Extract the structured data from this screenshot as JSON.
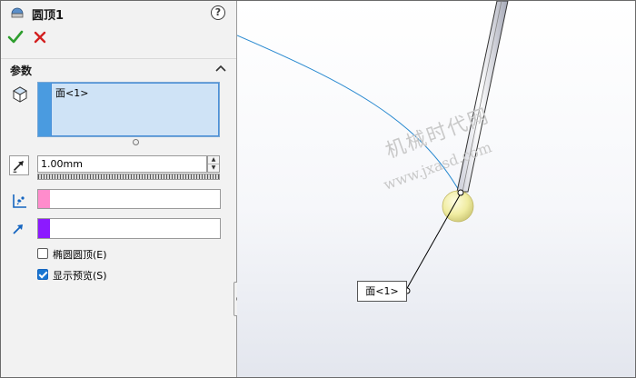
{
  "feature": {
    "title": "圆顶1"
  },
  "toolbar": {
    "help": "?"
  },
  "params": {
    "section_title": "参数",
    "selected_face": "面<1>",
    "distance_value": "1.00mm",
    "elliptical_label": "椭圆圆顶(E)",
    "elliptical_checked": false,
    "preview_label": "显示预览(S)",
    "preview_checked": true
  },
  "viewport": {
    "callout_label": "面<1>",
    "watermark_cn": "机械时代网",
    "watermark_url": "www.jxasd.com"
  },
  "colors": {
    "selection_blue": "#4a9be0",
    "vector_pink": "#ff8ccc",
    "direction_purple": "#8c1aff",
    "ok_green": "#2e9e2e",
    "cancel_red": "#d32020"
  }
}
